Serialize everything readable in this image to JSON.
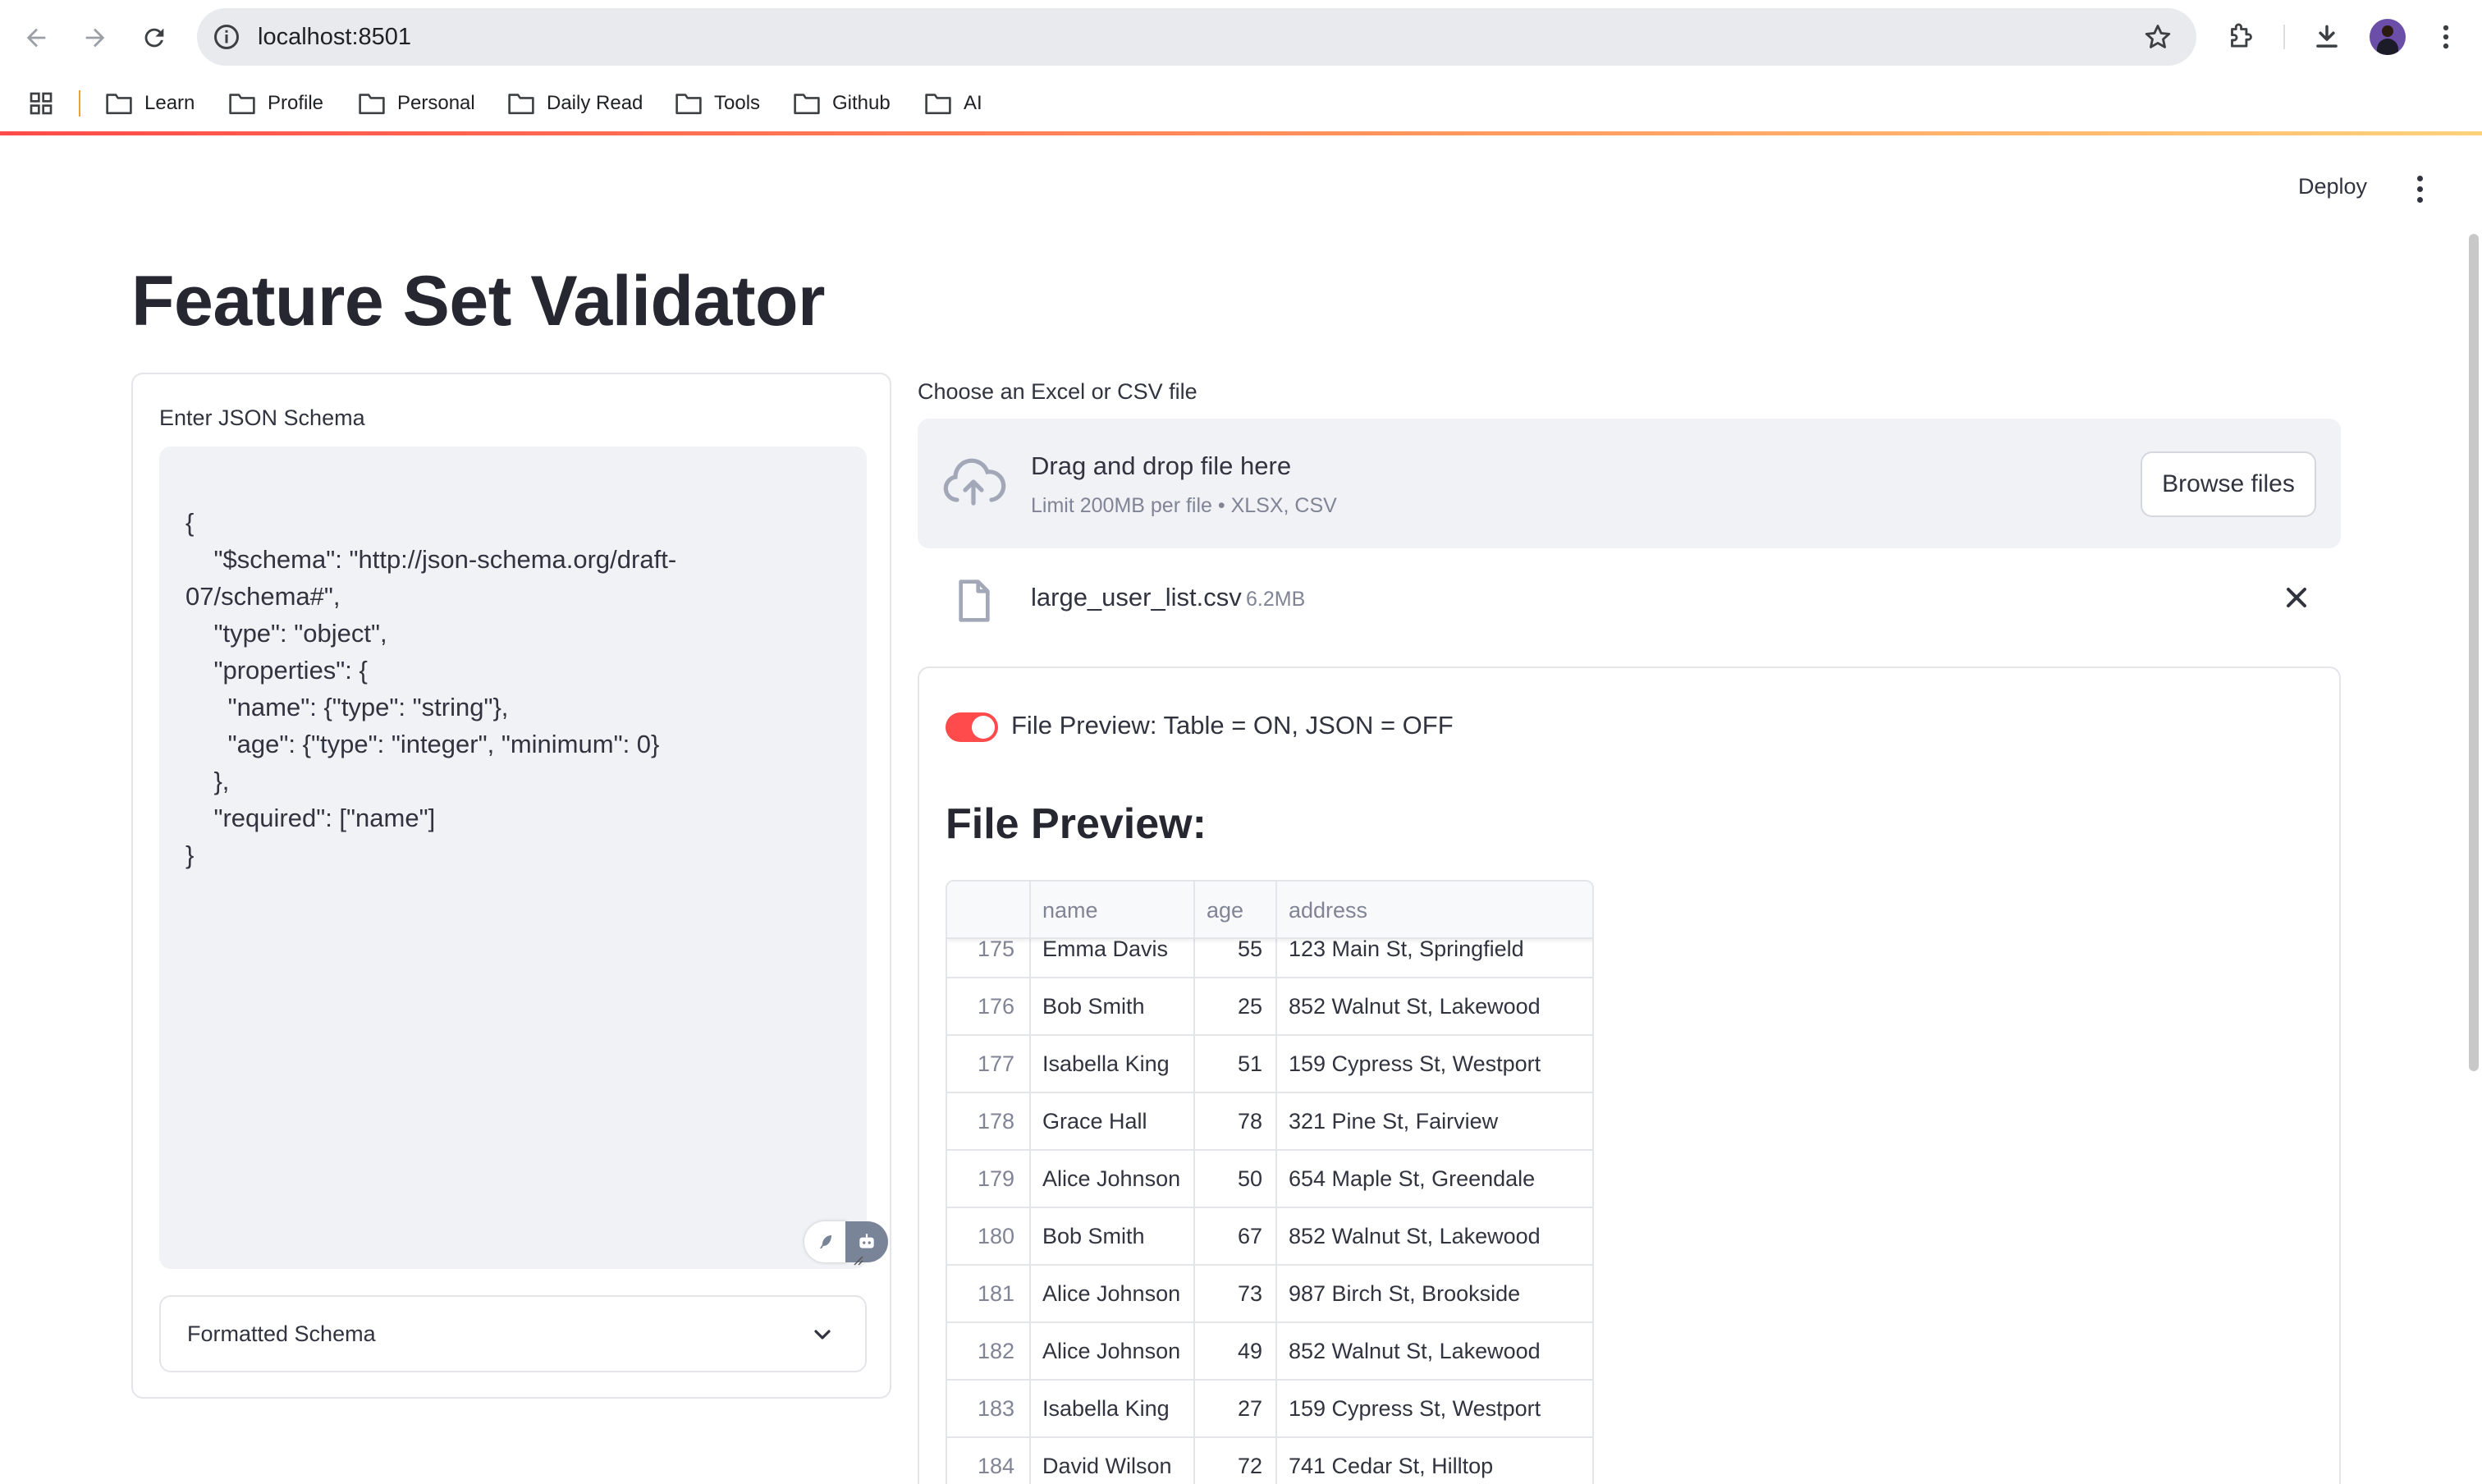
{
  "browser": {
    "url": "localhost:8501",
    "bookmarks": [
      "Learn",
      "Profile",
      "Personal",
      "Daily Read",
      "Tools",
      "Github",
      "AI"
    ]
  },
  "app": {
    "deploy_label": "Deploy",
    "title": "Feature Set Validator",
    "schema": {
      "label": "Enter JSON Schema",
      "text": "{\n    \"$schema\": \"http://json-schema.org/draft-\n07/schema#\",\n    \"type\": \"object\",\n    \"properties\": {\n      \"name\": {\"type\": \"string\"},\n      \"age\": {\"type\": \"integer\", \"minimum\": 0}\n    },\n    \"required\": [\"name\"]\n}",
      "expander_label": "Formatted Schema"
    },
    "upload": {
      "label": "Choose an Excel or CSV file",
      "drop_title": "Drag and drop file here",
      "drop_sub": "Limit 200MB per file • XLSX, CSV",
      "browse_label": "Browse files",
      "file_name": "large_user_list.csv",
      "file_size": "6.2MB"
    },
    "preview": {
      "toggle_label": "File Preview: Table = ON, JSON = OFF",
      "toggle_on": true,
      "heading": "File Preview:",
      "columns": [
        "",
        "name",
        "age",
        "address"
      ],
      "rows": [
        {
          "idx": "175",
          "name": "Emma Davis",
          "age": "55",
          "address": "123 Main St, Springfield"
        },
        {
          "idx": "176",
          "name": "Bob Smith",
          "age": "25",
          "address": "852 Walnut St, Lakewood"
        },
        {
          "idx": "177",
          "name": "Isabella King",
          "age": "51",
          "address": "159 Cypress St, Westport"
        },
        {
          "idx": "178",
          "name": "Grace Hall",
          "age": "78",
          "address": "321 Pine St, Fairview"
        },
        {
          "idx": "179",
          "name": "Alice Johnson",
          "age": "50",
          "address": "654 Maple St, Greendale"
        },
        {
          "idx": "180",
          "name": "Bob Smith",
          "age": "67",
          "address": "852 Walnut St, Lakewood"
        },
        {
          "idx": "181",
          "name": "Alice Johnson",
          "age": "73",
          "address": "987 Birch St, Brookside"
        },
        {
          "idx": "182",
          "name": "Alice Johnson",
          "age": "49",
          "address": "852 Walnut St, Lakewood"
        },
        {
          "idx": "183",
          "name": "Isabella King",
          "age": "27",
          "address": "159 Cypress St, Westport"
        },
        {
          "idx": "184",
          "name": "David Wilson",
          "age": "72",
          "address": "741 Cedar St, Hilltop"
        }
      ]
    }
  },
  "colors": {
    "accent": "#ff4b4b",
    "text": "#31333f",
    "muted": "#808495",
    "input_bg": "#f0f2f6",
    "border": "#e4e5e9"
  }
}
